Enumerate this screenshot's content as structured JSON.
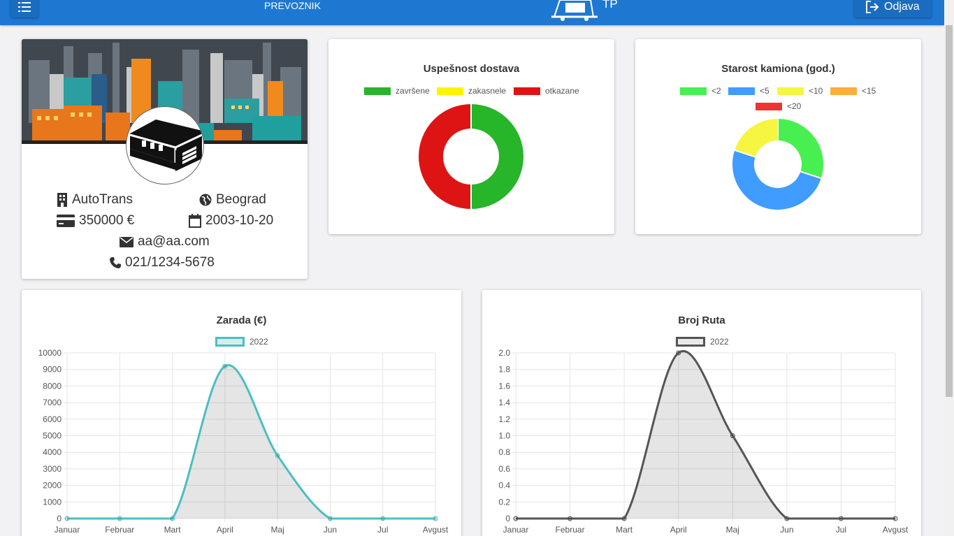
{
  "header": {
    "role": "PREVOZNIK",
    "logo_text": "TP",
    "logout_label": "Odjava"
  },
  "profile": {
    "name": "AutoTrans",
    "city": "Beograd",
    "capital": "350000 €",
    "date": "2003-10-20",
    "email": "aa@aa.com",
    "phone": "021/1234-5678"
  },
  "charts": {
    "delivery": {
      "title": "Uspešnost dostava",
      "legend": [
        {
          "label": "završene",
          "color": "#27b52a"
        },
        {
          "label": "zakasnele",
          "color": "#fff400"
        },
        {
          "label": "otkazane",
          "color": "#de1414"
        }
      ]
    },
    "truck_age": {
      "title": "Starost kamiona (god.)",
      "legend": [
        {
          "label": "<2",
          "color": "#47f050"
        },
        {
          "label": "<5",
          "color": "#409cff"
        },
        {
          "label": "<10",
          "color": "#f6f53f"
        },
        {
          "label": "<15",
          "color": "#ffad3b"
        },
        {
          "label": "<20",
          "color": "#f03333"
        }
      ]
    },
    "earnings": {
      "title": "Zarada (€)",
      "series_name": "2022",
      "color": "#4bbfc0"
    },
    "routes": {
      "title": "Broj Ruta",
      "series_name": "2022",
      "color": "#555555"
    }
  },
  "chart_data": [
    {
      "type": "pie",
      "title": "Uspešnost dostava",
      "categories": [
        "završene",
        "zakasnele",
        "otkazane"
      ],
      "values": [
        1,
        0,
        1
      ],
      "colors": [
        "#27b52a",
        "#fff400",
        "#de1414"
      ]
    },
    {
      "type": "pie",
      "title": "Starost kamiona (god.)",
      "categories": [
        "<2",
        "<5",
        "<10",
        "<15",
        "<20"
      ],
      "values": [
        3,
        5,
        2,
        0,
        0
      ],
      "colors": [
        "#47f050",
        "#409cff",
        "#f6f53f",
        "#ffad3b",
        "#f03333"
      ]
    },
    {
      "type": "area",
      "title": "Zarada (€)",
      "categories": [
        "Januar",
        "Februar",
        "Mart",
        "April",
        "Maj",
        "Jun",
        "Jul",
        "Avgust"
      ],
      "series": [
        {
          "name": "2022",
          "values": [
            0,
            0,
            0,
            9200,
            3800,
            0,
            0,
            0
          ]
        }
      ],
      "ylim": [
        0,
        10000
      ],
      "yticks": [
        0,
        1000,
        2000,
        3000,
        4000,
        5000,
        6000,
        7000,
        8000,
        9000,
        10000
      ],
      "color": "#4bbfc0"
    },
    {
      "type": "area",
      "title": "Broj Ruta",
      "categories": [
        "Januar",
        "Februar",
        "Mart",
        "April",
        "Maj",
        "Jun",
        "Jul",
        "Avgust"
      ],
      "series": [
        {
          "name": "2022",
          "values": [
            0,
            0,
            0,
            2,
            1,
            0,
            0,
            0
          ]
        }
      ],
      "ylim": [
        0,
        2
      ],
      "yticks": [
        "0",
        "0.2",
        "0.4",
        "0.6",
        "0.8",
        "1.0",
        "1.2",
        "1.4",
        "1.6",
        "1.8",
        "2.0"
      ],
      "color": "#555555"
    }
  ]
}
